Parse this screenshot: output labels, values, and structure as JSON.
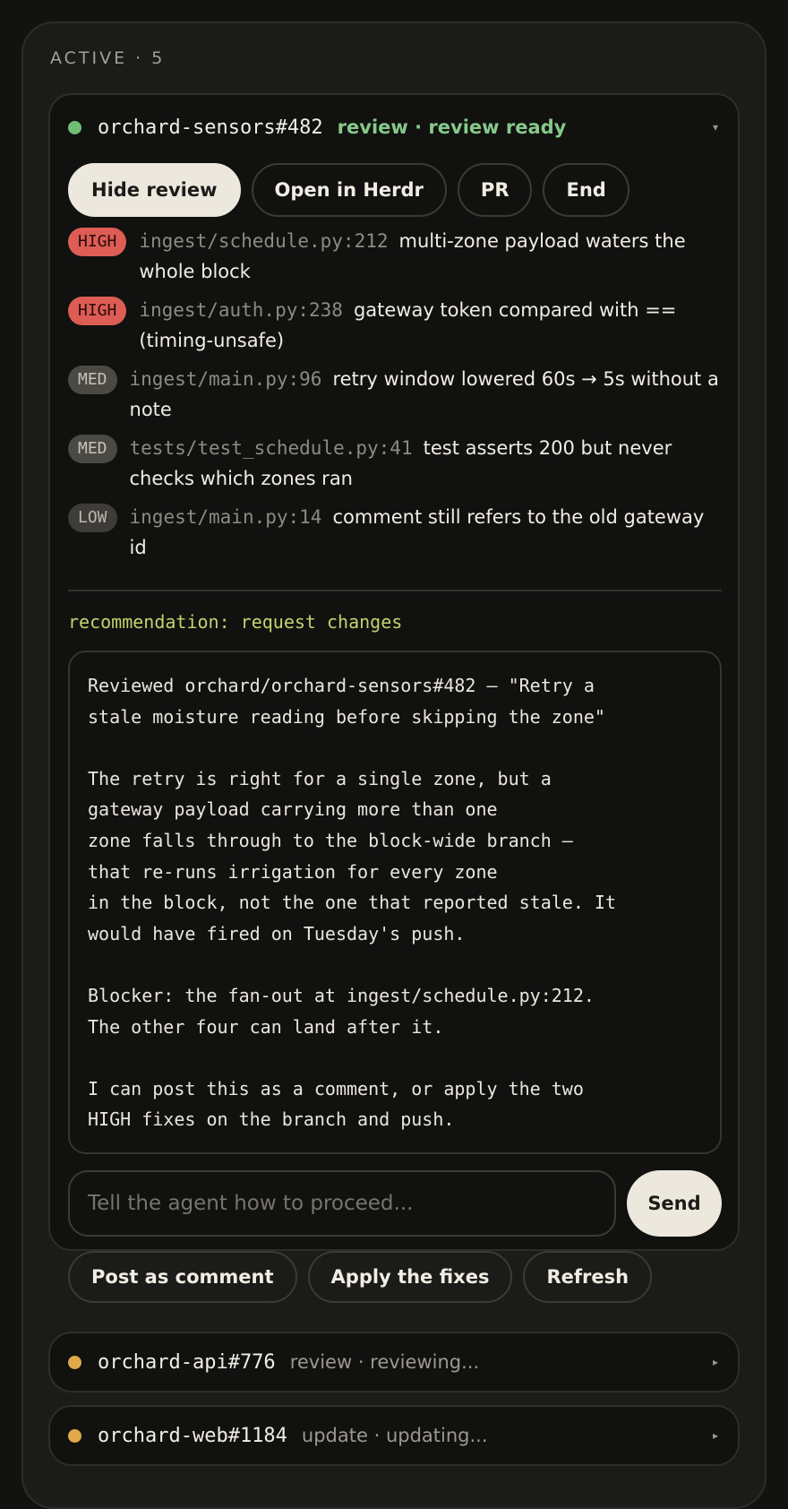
{
  "section": {
    "label": "ACTIVE · 5"
  },
  "colors": {
    "ready_dot": "#6fbf73",
    "ready_status": "#86c98a",
    "busy_dot": "#e0a94a",
    "busy_status": "#9c988f",
    "recommendation": "#c3d36a",
    "high_badge": "#dd5d55"
  },
  "sessions": [
    {
      "repo": "orchard-sensors#482",
      "status": "review · review ready",
      "state": "ready",
      "expanded": true,
      "actions": [
        {
          "label": "Hide review",
          "style": "light"
        },
        {
          "label": "Open in Herdr",
          "style": "outline"
        },
        {
          "label": "PR",
          "style": "outline"
        },
        {
          "label": "End",
          "style": "outline"
        }
      ],
      "findings": [
        {
          "severity": "HIGH",
          "location": "ingest/schedule.py:212",
          "message": "multi-zone payload waters the whole block"
        },
        {
          "severity": "HIGH",
          "location": "ingest/auth.py:238",
          "message": "gateway token compared with == (timing-unsafe)"
        },
        {
          "severity": "MED",
          "location": "ingest/main.py:96",
          "message": "retry window lowered 60s → 5s without a note"
        },
        {
          "severity": "MED",
          "location": "tests/test_schedule.py:41",
          "message": "test asserts 200 but never checks which zones ran"
        },
        {
          "severity": "LOW",
          "location": "ingest/main.py:14",
          "message": "comment still refers to the old gateway id"
        }
      ],
      "recommendation": "recommendation: request changes",
      "review_text": "Reviewed orchard/orchard-sensors#482 — \"Retry a\nstale moisture reading before skipping the zone\"\n\nThe retry is right for a single zone, but a\ngateway payload carrying more than one\nzone falls through to the block-wide branch —\nthat re-runs irrigation for every zone\nin the block, not the one that reported stale. It\nwould have fired on Tuesday's push.\n\nBlocker: the fan-out at ingest/schedule.py:212.\nThe other four can land after it.\n\nI can post this as a comment, or apply the two\nHIGH fixes on the branch and push.",
      "prompt": {
        "value": "",
        "placeholder": "Tell the agent how to proceed..."
      },
      "send_label": "Send",
      "quick_actions": [
        "Post as comment",
        "Apply the fixes",
        "Refresh"
      ]
    },
    {
      "repo": "orchard-api#776",
      "status": "review · reviewing...",
      "state": "busy",
      "expanded": false
    },
    {
      "repo": "orchard-web#1184",
      "status": "update · updating...",
      "state": "busy",
      "expanded": false
    }
  ],
  "icons": {
    "expanded_caret": "caret-down-icon",
    "collapsed_caret": "caret-right-icon",
    "status_dot": "status-dot-icon"
  },
  "carets": {
    "expanded": "▾",
    "collapsed": "▸"
  }
}
